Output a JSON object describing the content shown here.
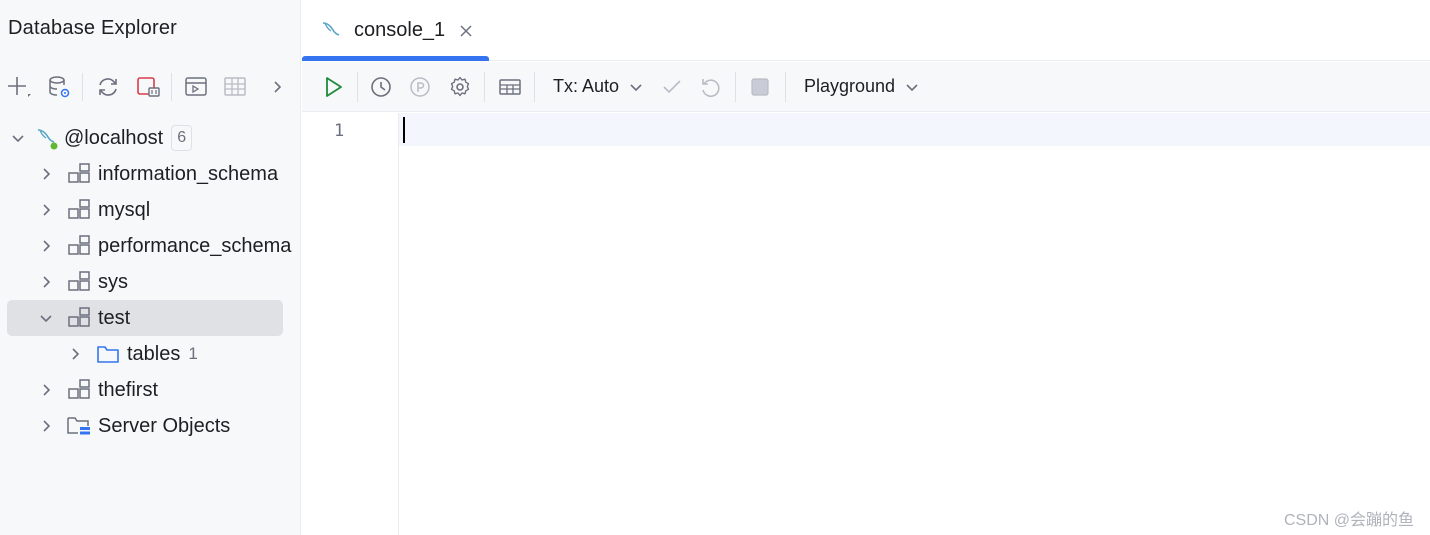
{
  "left_panel": {
    "title": "Database Explorer",
    "tree": {
      "root": {
        "label": "@localhost",
        "count": "6"
      },
      "items": [
        {
          "label": "information_schema"
        },
        {
          "label": "mysql"
        },
        {
          "label": "performance_schema"
        },
        {
          "label": "sys"
        },
        {
          "label": "test"
        },
        {
          "label": "tables",
          "count": "1"
        },
        {
          "label": "thefirst"
        },
        {
          "label": "Server Objects"
        }
      ]
    }
  },
  "editor": {
    "tab_label": "console_1",
    "toolbar": {
      "tx_label": "Tx: Auto",
      "playground_label": "Playground"
    },
    "line_number": "1"
  },
  "watermark": "CSDN @会蹦的鱼",
  "colors": {
    "accent": "#3574f0",
    "run_green": "#208a3c",
    "selection": "#dfe1e5",
    "icon_gray": "#6c707e",
    "status_green": "#5fb832"
  }
}
